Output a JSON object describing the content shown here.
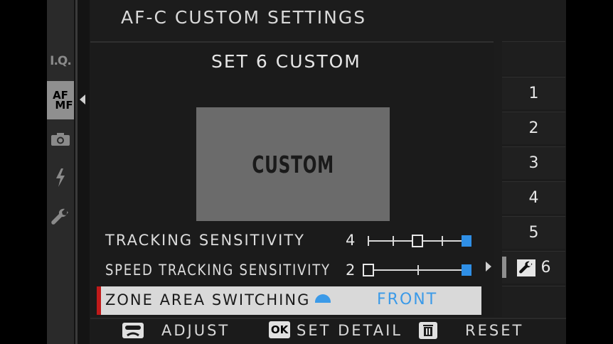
{
  "header": {
    "title": "AF-C CUSTOM SETTINGS"
  },
  "tabs": [
    {
      "name": "image-quality",
      "label": "I.Q."
    },
    {
      "name": "af-mf",
      "label_top": "AF",
      "label_bottom": "MF",
      "active": true
    },
    {
      "name": "shooting",
      "icon": "camera-icon"
    },
    {
      "name": "flash",
      "icon": "flash-icon"
    },
    {
      "name": "setup",
      "icon": "wrench-icon"
    }
  ],
  "main": {
    "subtitle": "SET 6 CUSTOM",
    "preview_label": "CUSTOM",
    "rows": [
      {
        "label": "TRACKING SENSITIVITY",
        "value": "4",
        "level": 4,
        "max": 4
      },
      {
        "label": "SPEED TRACKING SENSITIVITY",
        "value": "2",
        "level": 2,
        "max": 2
      }
    ],
    "selected_row": {
      "label": "ZONE AREA SWITCHING",
      "value": "FRONT",
      "icon": "zone-front-icon"
    }
  },
  "sets": {
    "items": [
      "1",
      "2",
      "3",
      "4",
      "5",
      "6"
    ],
    "current": "6",
    "current_icon": "wrench-icon"
  },
  "footer": {
    "adjust_label": "ADJUST",
    "ok_key": "OK",
    "set_detail_label": "SET DETAIL",
    "reset_label": "RESET"
  },
  "colors": {
    "accent_blue": "#3b9ae8",
    "selection_red": "#c01a1a",
    "selected_bg": "#d9d9d9"
  }
}
